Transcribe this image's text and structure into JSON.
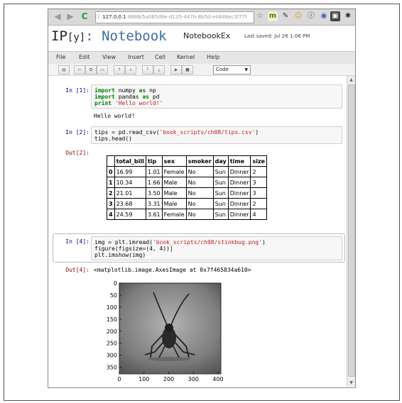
{
  "browser": {
    "url_host": "127.0.0.1",
    "url_rest": ":8888/5a085d6e-d135-447b-8b5d-e4848ec3f77f"
  },
  "notebook": {
    "logo_main": "IP",
    "logo_y": "[y]",
    "logo_suffix": ": Notebook",
    "name": "NotebookEx",
    "last_saved": "Last saved: Jul 26 1:06 PM"
  },
  "menu": [
    "File",
    "Edit",
    "View",
    "Insert",
    "Cell",
    "Kernel",
    "Help"
  ],
  "toolbar": {
    "cell_type": "Code"
  },
  "cells": {
    "c1": {
      "prompt": "In [1]:",
      "output": "Hello world!"
    },
    "c2": {
      "prompt": "In [2]:",
      "out_prompt": "Out[2]:"
    },
    "c4": {
      "prompt": "In [4]:",
      "out_prompt": "Out[4]:",
      "output": "<matplotlib.image.AxesImage at 0x7f465834a610>"
    }
  },
  "table": {
    "columns": [
      "",
      "total_bill",
      "tip",
      "sex",
      "smoker",
      "day",
      "time",
      "size"
    ],
    "rows": [
      [
        "0",
        "16.99",
        "1.01",
        "Female",
        "No",
        "Sun",
        "Dinner",
        "2"
      ],
      [
        "1",
        "10.34",
        "1.66",
        "Male",
        "No",
        "Sun",
        "Dinner",
        "3"
      ],
      [
        "2",
        "21.01",
        "3.50",
        "Male",
        "No",
        "Sun",
        "Dinner",
        "3"
      ],
      [
        "3",
        "23.68",
        "3.31",
        "Male",
        "No",
        "Sun",
        "Dinner",
        "2"
      ],
      [
        "4",
        "24.59",
        "3.61",
        "Female",
        "No",
        "Sun",
        "Dinner",
        "4"
      ]
    ]
  },
  "plot": {
    "y_ticks": [
      "0",
      "50",
      "100",
      "150",
      "200",
      "250",
      "300",
      "350"
    ],
    "x_ticks": [
      "0",
      "100",
      "200",
      "300",
      "400"
    ]
  }
}
